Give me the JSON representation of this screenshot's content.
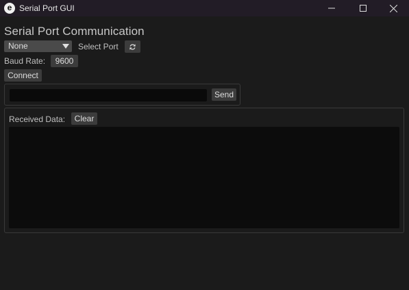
{
  "window": {
    "icon_letter": "e",
    "title": "Serial Port GUI"
  },
  "heading": "Serial Port Communication",
  "port": {
    "selected": "None",
    "label": "Select Port"
  },
  "baud": {
    "label": "Baud Rate:",
    "value": "9600"
  },
  "connect_label": "Connect",
  "send": {
    "input_value": "",
    "button_label": "Send"
  },
  "received": {
    "label": "Received Data:",
    "clear_label": "Clear",
    "content": ""
  },
  "colors": {
    "background": "#1b1b1b",
    "titlebar": "#221c26",
    "button": "#3c3c3c",
    "input": "#0a0a0a"
  }
}
